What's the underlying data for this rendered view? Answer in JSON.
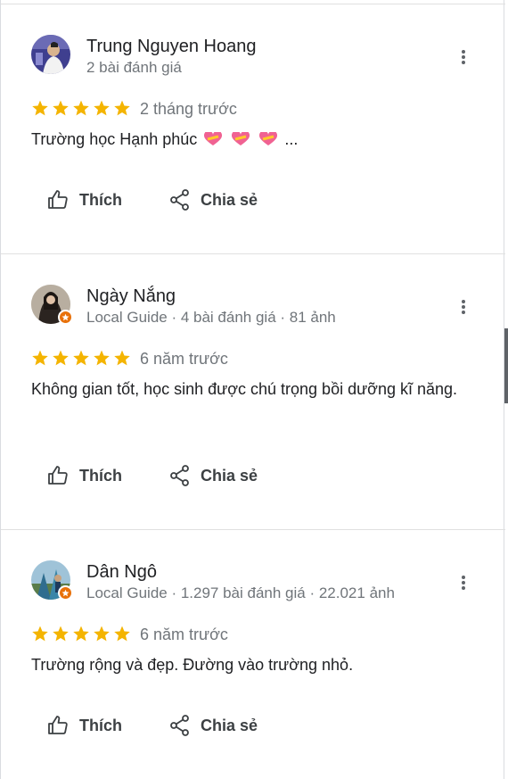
{
  "reviews": [
    {
      "name": "Trung Nguyen Hoang",
      "meta": "2 bài đánh giá",
      "local_guide": false,
      "rating": 5,
      "time": "2 tháng trước",
      "text": "Trường học Hạnh phúc",
      "text_suffix": "...",
      "like_label": "Thích",
      "share_label": "Chia sẻ"
    },
    {
      "name": "Ngày Nắng",
      "meta": "Local Guide · 4 bài đánh giá · 81 ảnh",
      "local_guide": true,
      "rating": 5,
      "time": "6 năm trước",
      "text": "Không gian tốt, học sinh được chú trọng bồi dưỡng kĩ năng.",
      "like_label": "Thích",
      "share_label": "Chia sẻ"
    },
    {
      "name": "Dân Ngô",
      "meta": "Local Guide · 1.297 bài đánh giá · 22.021 ảnh",
      "local_guide": true,
      "rating": 5,
      "time": "6 năm trước",
      "text": "Trường rộng và đẹp. Đường vào trường nhỏ.",
      "like_label": "Thích",
      "share_label": "Chia sẻ"
    }
  ],
  "colors": {
    "star": "#f4b400",
    "badge": "#e8710a",
    "divider": "#e0e0e0",
    "meta_text": "#70757a"
  },
  "icons": {
    "like": "thumbs-up-icon",
    "share": "share-icon",
    "more": "more-vert-icon",
    "star": "star-icon",
    "heart": "heart-emoji-icon"
  }
}
